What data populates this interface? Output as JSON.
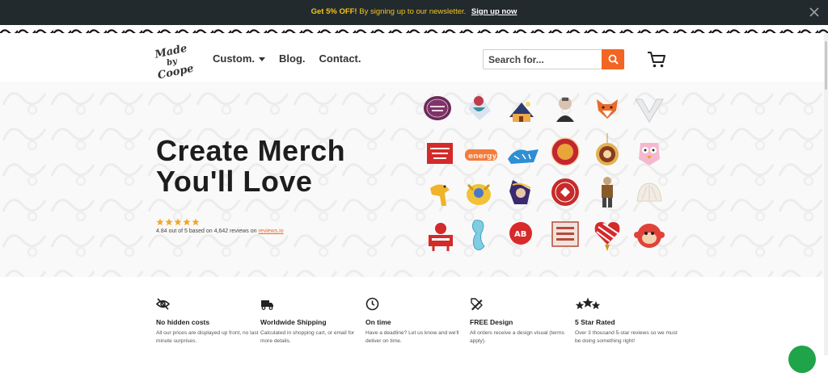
{
  "banner": {
    "highlight": "Get 5% OFF!",
    "text": "By signing up to our newsletter.",
    "link": "Sign up now"
  },
  "logo": {
    "lines": [
      "Made",
      "by",
      "Cooper"
    ]
  },
  "nav": [
    {
      "label": "Custom.",
      "has_dropdown": true
    },
    {
      "label": "Blog.",
      "has_dropdown": false
    },
    {
      "label": "Contact.",
      "has_dropdown": false
    }
  ],
  "search": {
    "placeholder": "Search for...",
    "value": ""
  },
  "hero": {
    "title_line1": "Create Merch",
    "title_line2": "You'll Love",
    "rating_stars": 4.84,
    "rating_text": "4.84 out of 5 based on 4,642 reviews on",
    "rating_link": "reviews.io"
  },
  "pin_icons": [
    "pin-about-beauty",
    "pin-mermaid",
    "pin-house-night",
    "pin-portrait-man",
    "pin-fox",
    "pin-white-v",
    "pin-red-label",
    "pin-energy",
    "pin-blue-tiger",
    "pin-red-round",
    "pin-pendant-coin",
    "pin-pink-owl",
    "pin-bird",
    "pin-yellow-pokemon",
    "pin-witch",
    "pin-red-seal",
    "pin-soldier",
    "pin-white-shell",
    "pin-red-creature",
    "pin-seahorse",
    "pin-ab-badge",
    "pin-rabbit-print",
    "pin-heart-stripes",
    "pin-monkey"
  ],
  "features": [
    {
      "icon": "eye-off-icon",
      "title": "No hidden costs",
      "desc": "All our prices are displayed up front, no last minute surprises."
    },
    {
      "icon": "truck-icon",
      "title": "Worldwide Shipping",
      "desc": "Calculated in shopping cart, or email for more details."
    },
    {
      "icon": "clock-icon",
      "title": "On time",
      "desc": "Have a deadline? Let us know and we'll deliver on time."
    },
    {
      "icon": "design-tools-icon",
      "title": "FREE Design",
      "desc": "All orders receive a design visual (terms apply)."
    },
    {
      "icon": "three-stars-icon",
      "title": "5 Star Rated",
      "desc": "Over 3 thousand 5-star reviews so we must be doing something right!"
    }
  ],
  "colors": {
    "accent": "#f26522",
    "banner_bg": "#222a2e",
    "banner_text": "#f5c518",
    "star": "#f5a623",
    "chat": "#1fa44a"
  }
}
